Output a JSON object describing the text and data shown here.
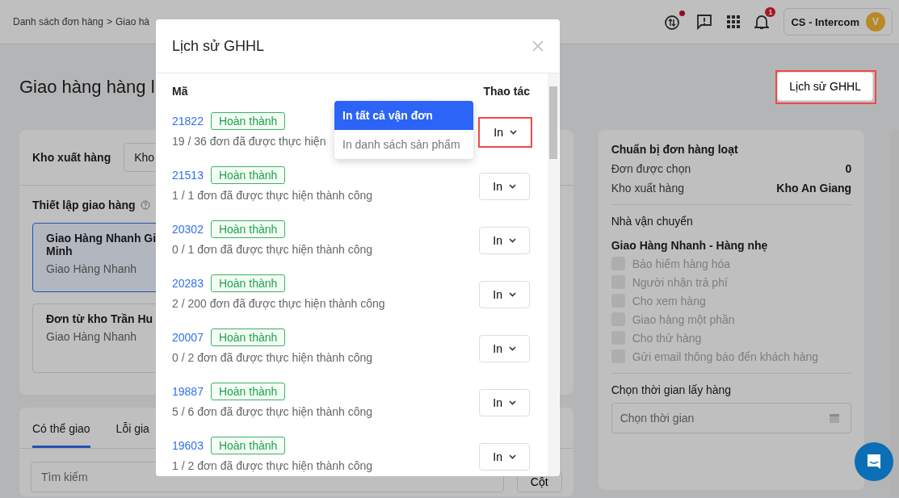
{
  "breadcrumb": {
    "separator": ">",
    "items": [
      {
        "label": "Danh sách đơn hàng"
      },
      {
        "label": "Giao hà"
      }
    ]
  },
  "header": {
    "sync_alert": true,
    "notification_count": "1",
    "account": {
      "name": "CS - Intercom",
      "avatar": "V"
    }
  },
  "page": {
    "title": "Giao hàng hàng l",
    "history_button": {
      "label": "Lịch sử GHHL",
      "highlighted": true
    }
  },
  "warehouse": {
    "label": "Kho xuất hàng",
    "value": "Kho"
  },
  "shipping_setup": {
    "label": "Thiết lập giao hàng",
    "options": [
      {
        "title_lines": [
          "Giao Hàng Nhanh Gi",
          "Minh"
        ],
        "carrier": "Giao Hàng Nhanh",
        "selected": true
      },
      {
        "title_lines": [
          "Đơn từ kho Trần Hu"
        ],
        "carrier": "Giao Hàng Nhanh",
        "selected": false
      }
    ]
  },
  "tabs": [
    {
      "label": "Có thể giao",
      "selected": true
    },
    {
      "label": "Lỗi gia",
      "selected": false
    }
  ],
  "search": {
    "placeholder": "Tìm kiếm"
  },
  "columns_button": "Cột",
  "summary": {
    "title": "Chuẩn bị đơn hàng loạt",
    "rows": [
      {
        "label": "Đơn được chọn",
        "value": "0"
      },
      {
        "label": "Kho xuất hàng",
        "value": "Kho An Giang"
      }
    ],
    "carrier_label": "Nhà vận chuyển",
    "carrier": "Giao Hàng Nhanh - Hàng nhẹ",
    "options": [
      {
        "label": "Bảo hiểm hàng hóa",
        "checked": false,
        "disabled": true
      },
      {
        "label": "Người nhận trả phí",
        "checked": false,
        "disabled": true
      },
      {
        "label": "Cho xem hàng",
        "checked": false,
        "disabled": true
      },
      {
        "label": "Giao hàng một phần",
        "checked": false,
        "disabled": true
      },
      {
        "label": "Cho thử hàng",
        "checked": false,
        "disabled": true
      },
      {
        "label": "Gửi email thông báo đến khách hàng",
        "checked": false,
        "disabled": true
      }
    ],
    "pickup_label": "Chọn thời gian lấy hàng",
    "pickup_field": {
      "placeholder": "Chọn thời gian"
    }
  },
  "modal": {
    "title": "Lịch sử GHHL",
    "columns": [
      "Mã",
      "Thao tác"
    ],
    "rows": [
      {
        "code": "21822",
        "status": "Hoàn thành",
        "progress": "19 / 36 đơn đã được thực hiện",
        "action": "In",
        "highlighted": true
      },
      {
        "code": "21513",
        "status": "Hoàn thành",
        "progress": "1 / 1 đơn đã được thực hiện thành công",
        "action": "In",
        "highlighted": false
      },
      {
        "code": "20302",
        "status": "Hoàn thành",
        "progress": "0 / 1 đơn đã được thực hiện thành công",
        "action": "In",
        "highlighted": false
      },
      {
        "code": "20283",
        "status": "Hoàn thành",
        "progress": "2 / 200 đơn đã được thực hiện thành công",
        "action": "In",
        "highlighted": false
      },
      {
        "code": "20007",
        "status": "Hoàn thành",
        "progress": "0 / 2 đơn đã được thực hiện thành công",
        "action": "In",
        "highlighted": false
      },
      {
        "code": "19887",
        "status": "Hoàn thành",
        "progress": "5 / 6 đơn đã được thực hiện thành công",
        "action": "In",
        "highlighted": false
      },
      {
        "code": "19603",
        "status": "Hoàn thành",
        "progress": "1 / 2 đơn đã được thực hiện thành công",
        "action": "In",
        "highlighted": false
      }
    ],
    "menu": [
      {
        "label": "In tất cả vận đơn",
        "selected": true
      },
      {
        "label": "In danh sách sản phẩm",
        "selected": false
      }
    ]
  }
}
